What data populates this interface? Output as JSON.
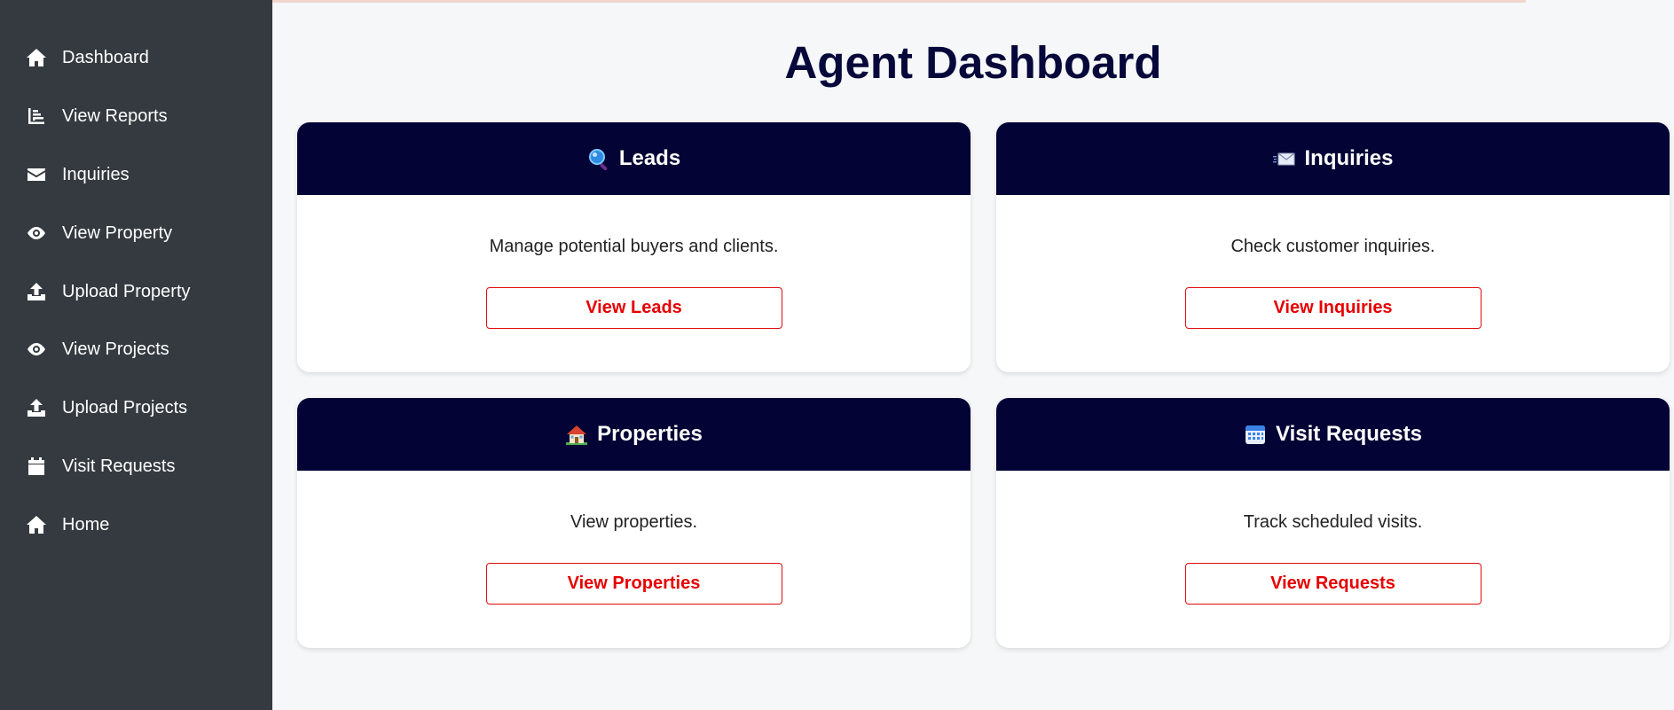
{
  "sidebar": {
    "items": [
      {
        "label": "Dashboard",
        "icon": "home-icon"
      },
      {
        "label": "View Reports",
        "icon": "chart-icon"
      },
      {
        "label": "Inquiries",
        "icon": "envelope-icon"
      },
      {
        "label": "View Property",
        "icon": "eye-icon"
      },
      {
        "label": "Upload Property",
        "icon": "upload-icon"
      },
      {
        "label": "View Projects",
        "icon": "eye-icon"
      },
      {
        "label": "Upload Projects",
        "icon": "upload-icon"
      },
      {
        "label": "Visit Requests",
        "icon": "calendar-icon"
      },
      {
        "label": "Home",
        "icon": "home-icon"
      }
    ]
  },
  "main": {
    "title": "Agent Dashboard",
    "cards": [
      {
        "title": "Leads",
        "icon": "magnifier-icon",
        "description": "Manage potential buyers and clients.",
        "button": "View Leads"
      },
      {
        "title": "Inquiries",
        "icon": "incoming-envelope-icon",
        "description": "Check customer inquiries.",
        "button": "View Inquiries"
      },
      {
        "title": "Properties",
        "icon": "house-icon",
        "description": "View properties.",
        "button": "View Properties"
      },
      {
        "title": "Visit Requests",
        "icon": "calendar-icon",
        "description": "Track scheduled visits.",
        "button": "View Requests"
      }
    ]
  },
  "colors": {
    "sidebar_bg": "#343a40",
    "card_header_bg": "#030335",
    "title_color": "#06083a",
    "button_accent": "#e60000",
    "page_bg": "#f6f7f9"
  }
}
